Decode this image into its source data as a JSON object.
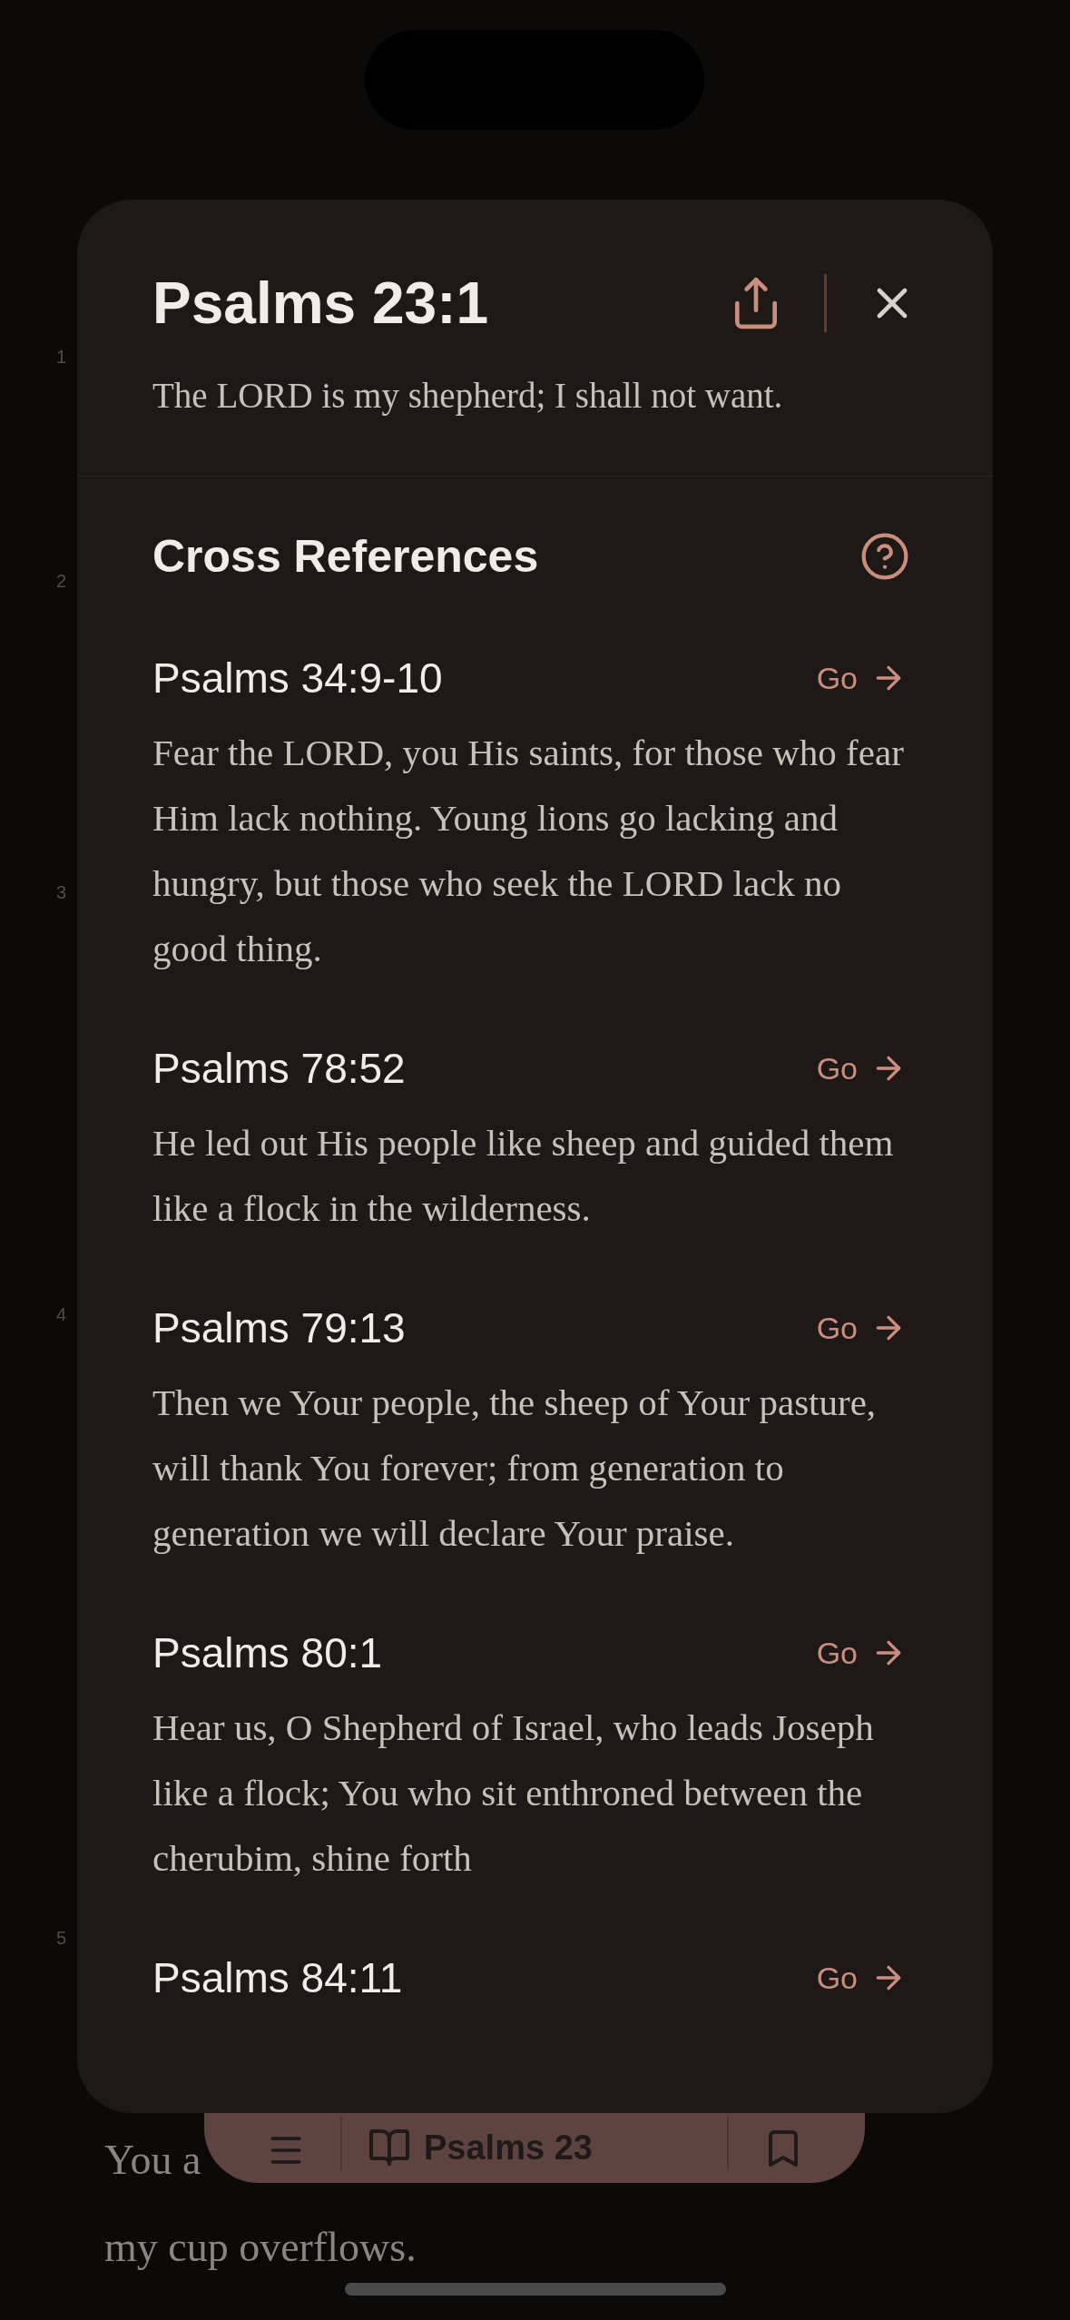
{
  "verse_numbers": [
    "1",
    "2",
    "3",
    "4",
    "5"
  ],
  "background_lines": [
    "You a",
    "my cup overflows."
  ],
  "modal": {
    "title": "Psalms 23:1",
    "verse_text": "The LORD is my shepherd; I shall not want.",
    "section_title": "Cross References",
    "references": [
      {
        "reference": "Psalms 34:9-10",
        "go_label": "Go",
        "text": "Fear the LORD, you His saints, for those who fear Him lack nothing. Young lions go lacking and hungry, but those who seek the LORD lack no good thing."
      },
      {
        "reference": "Psalms 78:52",
        "go_label": "Go",
        "text": "He led out His people like sheep and guided them like a flock in the wilderness."
      },
      {
        "reference": "Psalms 79:13",
        "go_label": "Go",
        "text": "Then we Your people, the sheep of Your pasture, will thank You forever; from generation to generation we will declare Your praise."
      },
      {
        "reference": "Psalms 80:1",
        "go_label": "Go",
        "text": "Hear us, O Shepherd of Israel, who leads Joseph like a flock; You who sit enthroned between the cherubim, shine forth"
      },
      {
        "reference": "Psalms 84:11",
        "go_label": "Go"
      }
    ]
  },
  "bottom_bar": {
    "title": "Psalms 23"
  }
}
